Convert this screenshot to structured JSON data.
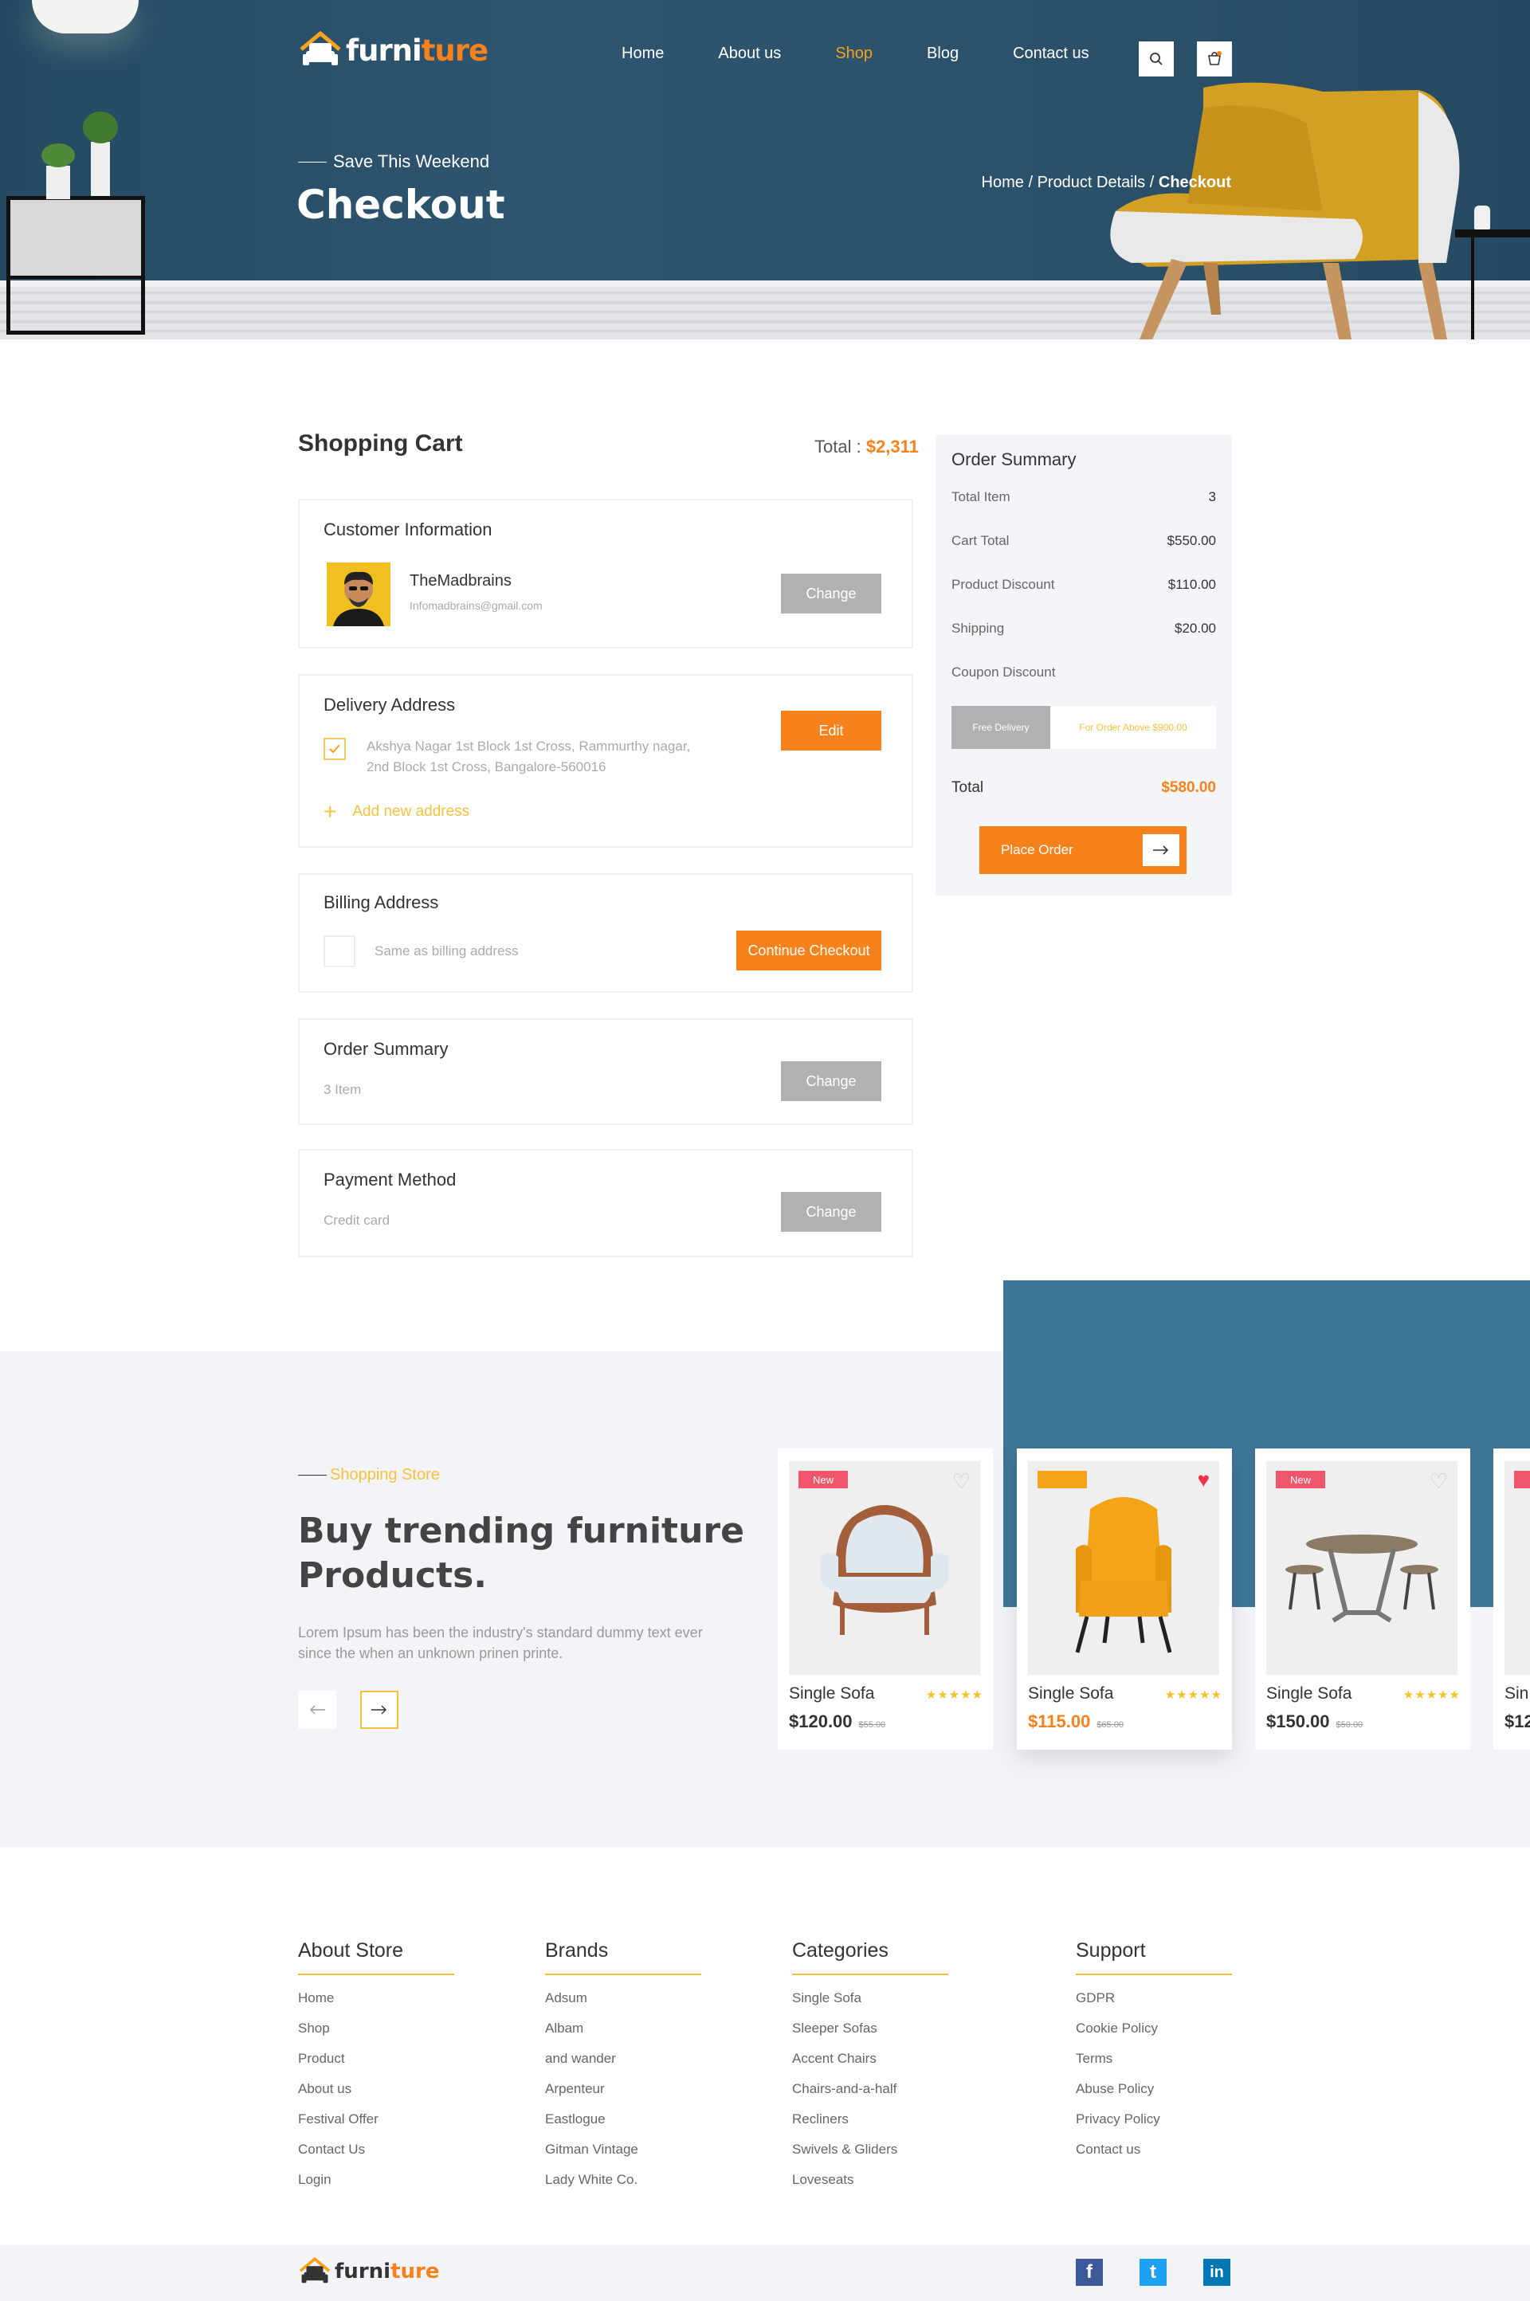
{
  "brand": {
    "name_part1": "furni",
    "name_part2": "ture"
  },
  "nav": {
    "items": [
      {
        "label": "Home",
        "active": false
      },
      {
        "label": "About us",
        "active": false
      },
      {
        "label": "Shop",
        "active": true
      },
      {
        "label": "Blog",
        "active": false
      },
      {
        "label": "Contact us",
        "active": false
      }
    ],
    "search_icon": "search-icon",
    "cart_icon": "cart-icon"
  },
  "hero": {
    "subtitle": "Save This Weekend",
    "title": "Checkout",
    "breadcrumb": {
      "home": "Home",
      "sep": "/",
      "product": "Product Details",
      "current": "Checkout"
    }
  },
  "cart": {
    "title": "Shopping Cart",
    "total_label": "Total :",
    "total_value": "$2,311"
  },
  "customer": {
    "title": "Customer Information",
    "name": "TheMadbrains",
    "email": "Infomadbrains@gmail.com",
    "button": "Change"
  },
  "delivery": {
    "title": "Delivery Address",
    "address_line1": "Akshya Nagar 1st Block 1st Cross, Rammurthy nagar,",
    "address_line2": "2nd Block 1st Cross, Bangalore-560016",
    "button": "Edit",
    "add_new": "Add new address"
  },
  "billing": {
    "title": "Billing Address",
    "same_label": "Same as billing address",
    "button": "Continue Checkout"
  },
  "order_card": {
    "title": "Order Summary",
    "items": "3 Item",
    "button": "Change"
  },
  "payment": {
    "title": "Payment Method",
    "method": "Credit card",
    "button": "Change"
  },
  "summary": {
    "title": "Order Summary",
    "rows": [
      {
        "label": "Total Item",
        "value": "3"
      },
      {
        "label": "Cart Total",
        "value": "$550.00"
      },
      {
        "label": "Product Discount",
        "value": "$110.00"
      },
      {
        "label": "Shipping",
        "value": "$20.00"
      },
      {
        "label": "Coupon Discount",
        "value": ""
      }
    ],
    "coupon_tag": "Free Delivery",
    "coupon_text": "For Order Above $900.00",
    "total_label": "Total",
    "total_value": "$580.00",
    "place_order": "Place Order"
  },
  "store": {
    "eyebrow": "Shopping Store",
    "heading_line1": "Buy trending furniture",
    "heading_line2": "Products.",
    "desc_line1": "Lorem Ipsum has been the industry's standard dummy text ever",
    "desc_line2": "since the when an unknown prinen printe."
  },
  "products": [
    {
      "badge": "New",
      "badge_color": "#f0566b",
      "name": "Single Sofa",
      "price": "$120.00",
      "old_price": "$55.00",
      "rating": "4.5 of 5",
      "liked": false,
      "price_color": "#333333"
    },
    {
      "badge": "",
      "badge_color": "#f7a21b",
      "name": "Single Sofa",
      "price": "$115.00",
      "old_price": "$65.00",
      "rating": "4.5 of 5",
      "liked": true,
      "price_color": "#f7821b"
    },
    {
      "badge": "New",
      "badge_color": "#f0566b",
      "name": "Single Sofa",
      "price": "$150.00",
      "old_price": "$50.00",
      "rating": "4.5 of 5",
      "liked": false,
      "price_color": "#333333"
    },
    {
      "badge": "",
      "badge_color": "#f0566b",
      "name": "Sin",
      "price": "$12",
      "old_price": "",
      "rating": "",
      "liked": false,
      "price_color": "#333333"
    }
  ],
  "footer": {
    "columns": [
      {
        "title": "About Store",
        "links": [
          "Home",
          "Shop",
          "Product",
          "About us",
          "Festival Offer",
          "Contact Us",
          "Login"
        ]
      },
      {
        "title": "Brands",
        "links": [
          "Adsum",
          "Albam",
          "and wander",
          "Arpenteur",
          "Eastlogue",
          "Gitman Vintage",
          "Lady White Co."
        ]
      },
      {
        "title": "Categories",
        "links": [
          "Single Sofa",
          "Sleeper Sofas",
          "Accent Chairs",
          "Chairs-and-a-half",
          "Recliners",
          "Swivels & Gliders",
          "Loveseats"
        ]
      },
      {
        "title": "Support",
        "links": [
          "GDPR",
          "Cookie Policy",
          "Terms",
          "Abuse Policy",
          "Privacy Policy",
          "Contact us"
        ]
      }
    ],
    "social": [
      {
        "icon": "facebook-icon",
        "glyph": "f",
        "color": "#3b5998"
      },
      {
        "icon": "twitter-icon",
        "glyph": "t",
        "color": "#1da1f2"
      },
      {
        "icon": "linkedin-icon",
        "glyph": "in",
        "color": "#0077b5"
      }
    ]
  },
  "colors": {
    "accent": "#f7821b",
    "yellow": "#f7a21b",
    "hero_bg": "#2c4f66",
    "blue_panel": "#3e7597",
    "button_grey": "#b1b1b1"
  }
}
